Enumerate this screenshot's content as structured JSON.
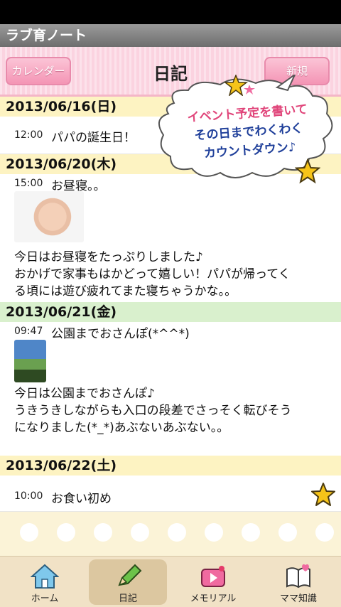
{
  "app": {
    "title": "ラブ育ノート"
  },
  "header": {
    "title": "日記",
    "calendar_button": "カレンダー",
    "new_button": "新規"
  },
  "callout": {
    "lines": [
      "イベント予定を書いて",
      "その日までわくわく",
      "カウントダウン♪"
    ]
  },
  "entries": [
    {
      "date": "2013/06/16(日)",
      "time": "12:00",
      "title": "パパの誕生日！"
    },
    {
      "date": "2013/06/20(木)",
      "time": "15:00",
      "title": "お昼寝。。",
      "body": [
        "今日はお昼寝をたっぷりしました♪",
        "おかげで家事もはかどって嬉しい！パパが帰ってく",
        "る頃には遊び疲れてまた寝ちゃうかな。。"
      ]
    },
    {
      "date": "2013/06/21(金)",
      "time": "09:47",
      "title": "公園までおさんぽ(*^^*)",
      "body": [
        "今日は公園までおさんぽ♪",
        "うきうきしながらも入口の段差でさっそく転びそう",
        "になりました(*_*)あぶないあぶない。。"
      ]
    },
    {
      "date": "2013/06/22(土)",
      "time": "10:00",
      "title": "お食い初め"
    }
  ],
  "tabs": [
    {
      "label": "ホーム",
      "icon": "home-icon"
    },
    {
      "label": "日記",
      "icon": "pencil-icon"
    },
    {
      "label": "メモリアル",
      "icon": "video-icon"
    },
    {
      "label": "ママ知識",
      "icon": "book-icon"
    }
  ],
  "colors": {
    "header_pink": "#fbd3e0",
    "date_yellow": "#fdf3c2",
    "date_green": "#d9f0cd",
    "accent_pink": "#f495b5",
    "star_yellow": "#f6c419"
  }
}
